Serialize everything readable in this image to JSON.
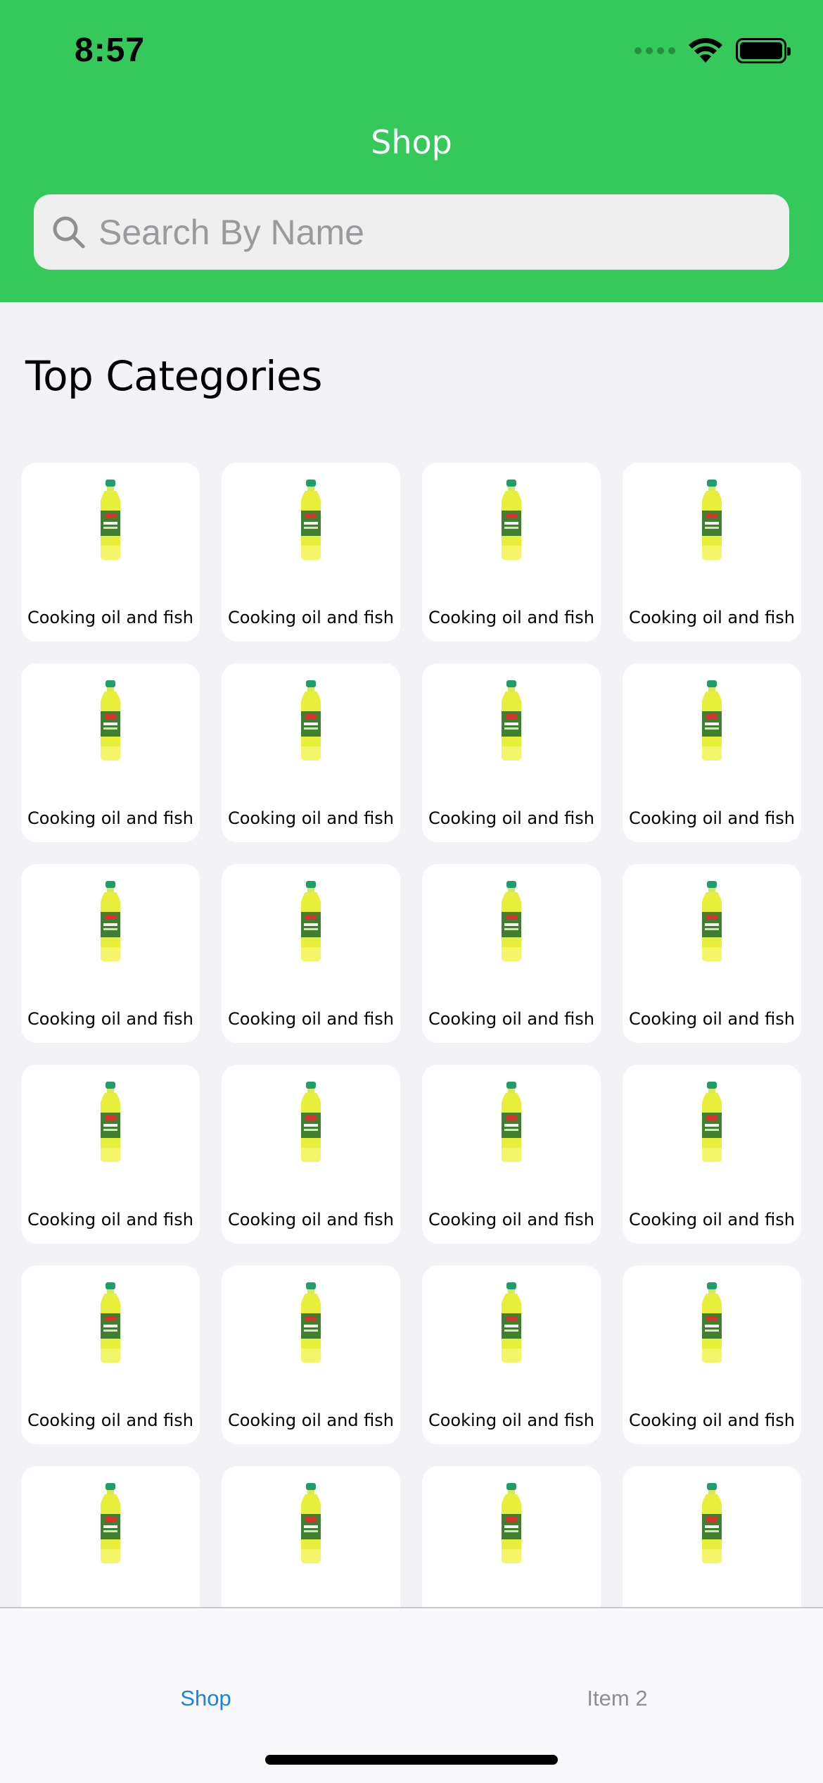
{
  "status_bar": {
    "time": "8:57"
  },
  "header": {
    "title": "Shop",
    "background_color": "#35c85b",
    "search": {
      "placeholder": "Search By Name",
      "value": "",
      "icon": "search-icon"
    }
  },
  "section": {
    "title": "Top Categories"
  },
  "categories": [
    {
      "label": "Cooking oil and fish",
      "icon": "oil-bottle-image"
    },
    {
      "label": "Cooking oil and fish",
      "icon": "oil-bottle-image"
    },
    {
      "label": "Cooking oil and fish",
      "icon": "oil-bottle-image"
    },
    {
      "label": "Cooking oil and fish",
      "icon": "oil-bottle-image"
    },
    {
      "label": "Cooking oil and fish",
      "icon": "oil-bottle-image"
    },
    {
      "label": "Cooking oil and fish",
      "icon": "oil-bottle-image"
    },
    {
      "label": "Cooking oil and fish",
      "icon": "oil-bottle-image"
    },
    {
      "label": "Cooking oil and fish",
      "icon": "oil-bottle-image"
    },
    {
      "label": "Cooking oil and fish",
      "icon": "oil-bottle-image"
    },
    {
      "label": "Cooking oil and fish",
      "icon": "oil-bottle-image"
    },
    {
      "label": "Cooking oil and fish",
      "icon": "oil-bottle-image"
    },
    {
      "label": "Cooking oil and fish",
      "icon": "oil-bottle-image"
    },
    {
      "label": "Cooking oil and fish",
      "icon": "oil-bottle-image"
    },
    {
      "label": "Cooking oil and fish",
      "icon": "oil-bottle-image"
    },
    {
      "label": "Cooking oil and fish",
      "icon": "oil-bottle-image"
    },
    {
      "label": "Cooking oil and fish",
      "icon": "oil-bottle-image"
    },
    {
      "label": "Cooking oil and fish",
      "icon": "oil-bottle-image"
    },
    {
      "label": "Cooking oil and fish",
      "icon": "oil-bottle-image"
    },
    {
      "label": "Cooking oil and fish",
      "icon": "oil-bottle-image"
    },
    {
      "label": "Cooking oil and fish",
      "icon": "oil-bottle-image"
    },
    {
      "label": "",
      "icon": "oil-bottle-image"
    },
    {
      "label": "",
      "icon": "oil-bottle-image"
    },
    {
      "label": "",
      "icon": "oil-bottle-image"
    },
    {
      "label": "",
      "icon": "oil-bottle-image"
    }
  ],
  "tab_bar": {
    "tabs": [
      {
        "label": "Shop",
        "active": true,
        "color": "#1a82e2"
      },
      {
        "label": "Item 2",
        "active": false,
        "color": "#8e8e93"
      }
    ]
  }
}
